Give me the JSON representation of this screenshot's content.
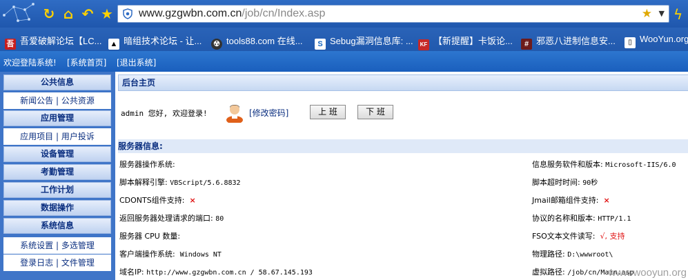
{
  "browser": {
    "url_domain": "www.gzgwbn.com.cn",
    "url_path": "/job/cn/Index.asp",
    "bookmarks": [
      {
        "label": "吾爱破解论坛【LC...",
        "icon": "52pojie-icon",
        "color": "#c81e1e"
      },
      {
        "label": "暗组技术论坛 - 让...",
        "icon": "darkgroup-icon",
        "color": "#000000"
      },
      {
        "label": "tools88.com 在线...",
        "icon": "tools88-icon",
        "color": "#333333"
      },
      {
        "label": "Sebug漏洞信息库: ...",
        "icon": "sebug-icon",
        "color": "#1565c0"
      },
      {
        "label": "【新提醒】卡饭论...",
        "icon": "kafan-icon",
        "color": "#c62828"
      },
      {
        "label": "邪恶八进制信息安...",
        "icon": "eviloctal-icon",
        "color": "#6d1b1b"
      },
      {
        "label": "WooYun.org",
        "icon": "page-icon",
        "color": "#ffffff"
      }
    ]
  },
  "topbar": {
    "welcome": "欢迎登陆系统!",
    "home_link": "[系统首页]",
    "logout_link": "[退出系统]"
  },
  "sidebar": {
    "sections": [
      {
        "title": "公共信息",
        "sub": "新闻公告 | 公共资源"
      },
      {
        "title": "应用管理",
        "sub": "应用项目 | 用户投诉"
      },
      {
        "title": "设备管理"
      },
      {
        "title": "考勤管理"
      },
      {
        "title": "工作计划"
      },
      {
        "title": "数据操作"
      },
      {
        "title": "系统信息",
        "sub": "系统设置 | 多选管理",
        "sub2": "登录日志 | 文件管理"
      }
    ]
  },
  "main": {
    "panel_title": "后台主页",
    "welcome_text": "admin 您好, 欢迎登录!",
    "change_password": "[修改密码]",
    "clock_in": "上 班",
    "clock_out": "下 班",
    "server_info_title": "服务器信息:",
    "rows": [
      {
        "left_label": "服务器操作系统:",
        "left_value": "",
        "right_label": "信息服务软件和版本:",
        "right_value": "Microsoft-IIS/6.0"
      },
      {
        "left_label": "脚本解释引擎:",
        "left_value": "VBScript/5.6.8832",
        "right_label": "脚本超时时间:",
        "right_value": "90秒"
      },
      {
        "left_label": "CDONTS组件支持:",
        "left_value": "×",
        "right_label": "Jmail邮箱组件支持:",
        "right_value": "×"
      },
      {
        "left_label": "返回服务器处理请求的端口:",
        "left_value": "80",
        "right_label": "协议的名称和版本:",
        "right_value": "HTTP/1.1"
      },
      {
        "left_label": "服务器 CPU 数量:",
        "left_value": "",
        "right_label": "FSO文本文件读写:",
        "right_value": "√, 支持"
      },
      {
        "left_label": "客户端操作系统:",
        "left_value": "Windows NT",
        "right_label": "物理路径:",
        "right_value": "D:\\wwwroot\\"
      },
      {
        "left_label": "域名IP:",
        "left_value": "http://www.gzgwbn.com.cn / 58.67.145.193",
        "right_label": "虚拟路径:",
        "right_value": "/job/cn/Main.asp"
      }
    ]
  },
  "watermark": "www.wooyun.org"
}
